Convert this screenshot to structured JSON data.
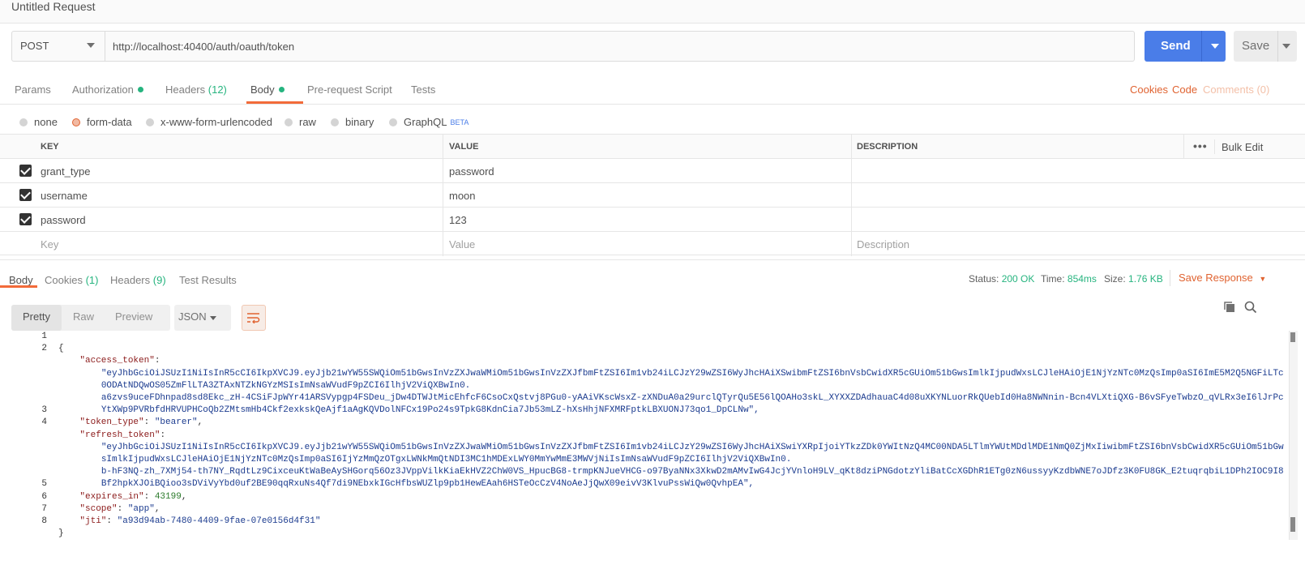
{
  "window": {
    "title": "Untitled Request"
  },
  "request": {
    "method": "POST",
    "url": "http://localhost:40400/auth/oauth/token",
    "send_label": "Send",
    "save_label": "Save"
  },
  "tabs": {
    "params": "Params",
    "authorization": "Authorization",
    "headers": "Headers",
    "headers_count": "(12)",
    "body": "Body",
    "prerequest": "Pre-request Script",
    "tests": "Tests",
    "cookies": "Cookies",
    "code": "Code",
    "comments": "Comments (0)"
  },
  "body_types": {
    "none": "none",
    "form_data": "form-data",
    "urlencoded": "x-www-form-urlencoded",
    "raw": "raw",
    "binary": "binary",
    "graphql": "GraphQL",
    "beta": "BETA",
    "selected": "form-data"
  },
  "form_table": {
    "headers": {
      "key": "KEY",
      "value": "VALUE",
      "description": "DESCRIPTION",
      "bulk_edit": "Bulk Edit"
    },
    "rows": [
      {
        "checked": true,
        "key": "grant_type",
        "value": "password",
        "description": ""
      },
      {
        "checked": true,
        "key": "username",
        "value": "moon",
        "description": ""
      },
      {
        "checked": true,
        "key": "password",
        "value": "123",
        "description": ""
      }
    ],
    "placeholders": {
      "key": "Key",
      "value": "Value",
      "description": "Description"
    }
  },
  "response": {
    "tabs": {
      "body": "Body",
      "cookies": "Cookies",
      "cookies_count": "(1)",
      "headers": "Headers",
      "headers_count": "(9)",
      "test_results": "Test Results"
    },
    "status_label": "Status:",
    "status": "200 OK",
    "time_label": "Time:",
    "time": "854ms",
    "size_label": "Size:",
    "size": "1.76 KB",
    "save_response": "Save Response",
    "view_modes": {
      "pretty": "Pretty",
      "raw": "Raw",
      "preview": "Preview"
    },
    "format": "JSON",
    "line_numbers": [
      "1",
      "2",
      "3",
      "4",
      "5",
      "6",
      "7",
      "8"
    ],
    "json_lines": {
      "l1": "{",
      "access_token_key": "\"access_token\"",
      "access_token_v1": "\"eyJhbGciOiJSUzI1NiIsInR5cCI6IkpXVCJ9.eyJjb21wYW55SWQiOm51bGwsInVzZXJwaWMiOm51bGwsInVzZXJfbmFtZSI6Im1vb24iLCJzY29wZSI6WyJhcHAiXSwibmFtZSI6bnVsbCwidXR5cGUiOm51bGwsImlkIjpudWxsLCJleHAiOjE1NjYzNTc0MzQsImp0aSI6ImE5M2Q5NGFiLTc",
      "access_token_v2": "0ODAtNDQwOS05ZmFlLTA3ZTAxNTZkNGYzMSIsImNsaWVudF9pZCI6IlhjV2ViQXBwIn0.",
      "access_token_v3": "a6zvs9uceFDhnpad8sd8Ekc_zH-4CSiFJpWYr41ARSVypgp4FSDeu_jDw4DTWJtMicEhfcF6CsoCxQstvj8PGu0-yAAiVKscWsxZ-zXNDuA0a29urclQTyrQu5E56lQOAHo3skL_XYXXZDAdhauaC4d08uXKYNLuorRkQUebId0Ha8NWNnin-Bcn4VLXtiQXG-B6vSFyeTwbzO_qVLRx3eI6lJrPc",
      "access_token_v4": "YtXWp9PVRbfdHRVUPHCoQb2ZMtsmHb4Ckf2exkskQeAjf1aAgKQVDolNFCx19Po24s9TpkG8KdnCia7Jb53mLZ-hXsHhjNFXMRFptkLBXUONJ73qo1_DpCLNw\",",
      "token_type_key": "\"token_type\"",
      "token_type_val": "\"bearer\"",
      "refresh_token_key": "\"refresh_token\"",
      "refresh_token_v1": "\"eyJhbGciOiJSUzI1NiIsInR5cCI6IkpXVCJ9.eyJjb21wYW55SWQiOm51bGwsInVzZXJwaWMiOm51bGwsInVzZXJfbmFtZSI6Im1vb24iLCJzY29wZSI6WyJhcHAiXSwiYXRpIjoiYTkzZDk0YWItNzQ4MC00NDA5LTlmYWUtMDdlMDE1NmQ0ZjMxIiwibmFtZSI6bnVsbCwidXR5cGUiOm51bGw",
      "refresh_token_v2": "sImlkIjpudWxsLCJleHAiOjE1NjYzNTc0MzQsImp0aSI6IjYzMmQzOTgxLWNkMmQtNDI3MC1hMDExLWY0MmYwMmE3MWVjNiIsImNsaWVudF9pZCI6IlhjV2ViQXBwIn0.",
      "refresh_token_v3": "b-hF3NQ-zh_7XMj54-th7NY_RqdtLz9CixceuKtWaBeAySHGorq56Oz3JVppVilkKiaEkHVZ2ChW0VS_HpucBG8-trmpKNJueVHCG-o97ByaNNx3XkwD2mAMvIwG4JcjYVnloH9LV_qKt8dziPNGdotzYliBatCcXGDhR1ETg0zN6ussyyKzdbWNE7oJDfz3K0FU8GK_E2tuqrqbiL1DPh2IOC9I8",
      "refresh_token_v4": "Bf2hpkXJOiBQioo3sDViVyYbd0uf2BE90qqRxuNs4Qf7di9NEbxkIGcHfbsWUZlp9pb1HewEAah6HSTeOcCzV4NoAeJjQwX09eivV3KlvuPssWiQw0QvhpEA\",",
      "expires_in_key": "\"expires_in\"",
      "expires_in_val": "43199",
      "scope_key": "\"scope\"",
      "scope_val": "\"app\"",
      "jti_key": "\"jti\"",
      "jti_val": "\"a93d94ab-7480-4409-9fae-07e0156d4f31\"",
      "l8": "}"
    }
  },
  "colors": {
    "accent": "#f26b3a",
    "send": "#4a7de8",
    "status_ok": "#26b47f"
  }
}
